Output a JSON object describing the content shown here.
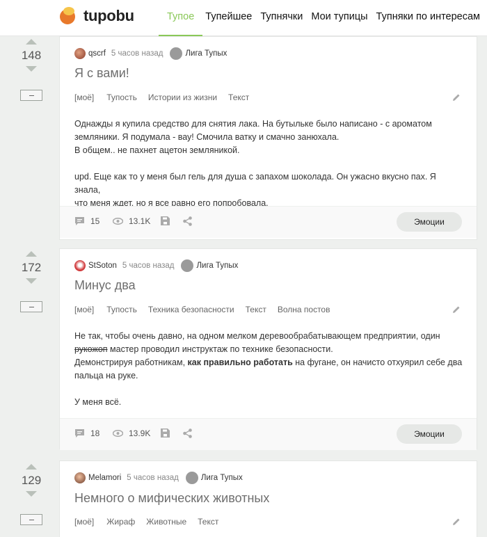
{
  "header": {
    "logo_text": "tupobu",
    "nav": [
      "Тупое",
      "Тупейшее",
      "Тупнячки",
      "Мои тупицы",
      "Тупняки по интересам"
    ]
  },
  "colors": {
    "accent": "#8ac858",
    "logo_orange": "#e8792b",
    "logo_yellow": "#f6c54b"
  },
  "posts": [
    {
      "rating": "148",
      "author": "qscrf",
      "time": "5 часов назад",
      "community": "Лига Тупых",
      "title": "Я с вами!",
      "tags": [
        "[моё]",
        "Тупость",
        "Истории из жизни",
        "Текст"
      ],
      "body": [
        "Однажды я купила средство для снятия лака. На бутыльке было написано - с ароматом",
        "земляники. Я подумала - вау! Смочила ватку и смачно занюхала.",
        "В общем.. не пахнет ацетон земляникой.",
        "upd. Еще как то у меня был гель для душа с запахом шоколада. Он ужасно вкусно пах. Я знала,",
        "что меня ждет, но я все равно его попробовала."
      ],
      "comments": "15",
      "views": "13.1K",
      "emotions_label": "Эмоции"
    },
    {
      "rating": "172",
      "author": "StSoton",
      "time": "5 часов назад",
      "community": "Лига Тупых",
      "title": "Минус два",
      "tags": [
        "[моё]",
        "Тупость",
        "Техника безопасности",
        "Текст",
        "Волна постов"
      ],
      "body": {
        "line1": "Не так, чтобы очень давно, на одном мелком деревообрабатывающем предприятии, один",
        "strike": "рукожоп",
        "line2_rest": " мастер проводил инструктаж по технике безопасности.",
        "line3_start": "Демонстрируя работникам, ",
        "line3_bold": "как правильно работать",
        "line3_end": " на фугане, он начисто отхуярил себе два",
        "line4": "пальца на руке.",
        "line5": "У меня всё."
      },
      "comments": "18",
      "views": "13.9K",
      "emotions_label": "Эмоции"
    },
    {
      "rating": "129",
      "author": "Melamori",
      "time": "5 часов назад",
      "community": "Лига Тупых",
      "title": "Немного о мифических животных",
      "tags": [
        "[моё]",
        "Жираф",
        "Животные",
        "Текст"
      ]
    }
  ]
}
